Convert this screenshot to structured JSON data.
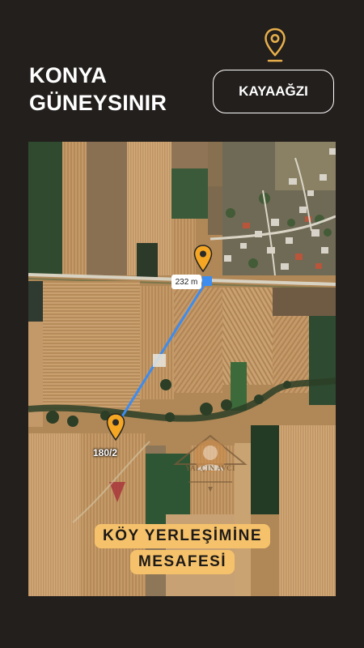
{
  "header": {
    "title_line1": "KONYA",
    "title_line2": "GÜNEYSINIR",
    "location_badge": "KAYAAĞZI",
    "icon": "location-pin-icon"
  },
  "map": {
    "distance_label": "232 m",
    "parcel_label": "180/2",
    "watermark_brand": "YALÇIN AVCI",
    "route_color": "#3d8cf0",
    "pin_color": "#f5a623"
  },
  "caption": {
    "line1": "KÖY YERLEŞİMİNE",
    "line2": "MESAFESİ"
  },
  "colors": {
    "background": "#231f1d",
    "caption_bg": "#f5c26b",
    "pin": "#f5a623"
  }
}
